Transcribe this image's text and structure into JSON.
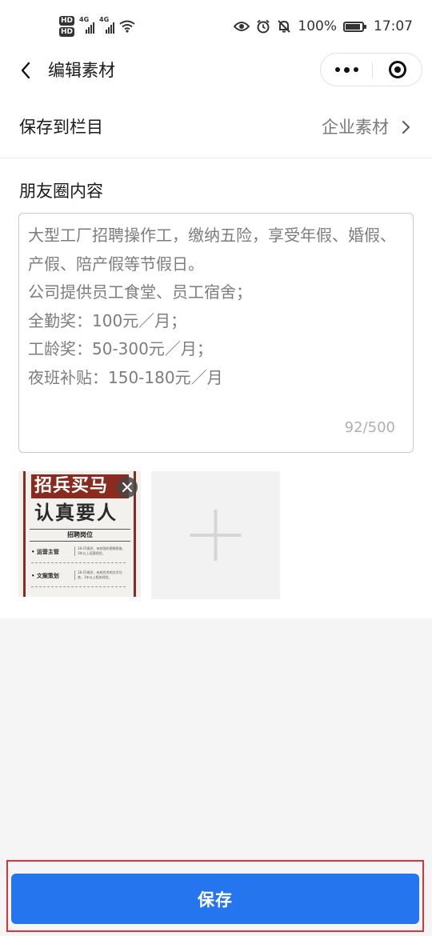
{
  "status_bar": {
    "hd1": "HD",
    "hd2": "HD",
    "net1": "4G",
    "net2": "4G",
    "battery": "100%",
    "time": "17:07"
  },
  "nav": {
    "title": "编辑素材"
  },
  "column_row": {
    "label": "保存到栏目",
    "value": "企业素材"
  },
  "content": {
    "label": "朋友圈内容",
    "text": "大型工厂招聘操作工，缴纳五险，享受年假、婚假、产假、陪产假等节假日。\n公司提供员工食堂、员工宿舍；\n全勤奖：100元／月；\n工龄奖：50-300元／月；\n夜班补贴：150-180元／月",
    "counter": "92/500"
  },
  "image": {
    "band": "招兵买马",
    "headline": "认真要人",
    "subtitle": "招聘岗位",
    "item1": "• 运营主管",
    "desc1": "18-25周岁，有较强的逻辑思维，3年以上运营经验。",
    "item2": "• 文案策划",
    "desc2": "18-25周岁，有较优秀的文字功底，1年以上相关经验。"
  },
  "footer": {
    "save_label": "保存"
  },
  "colors": {
    "primary": "#2576ee",
    "highlight_outline": "#d8343a"
  }
}
